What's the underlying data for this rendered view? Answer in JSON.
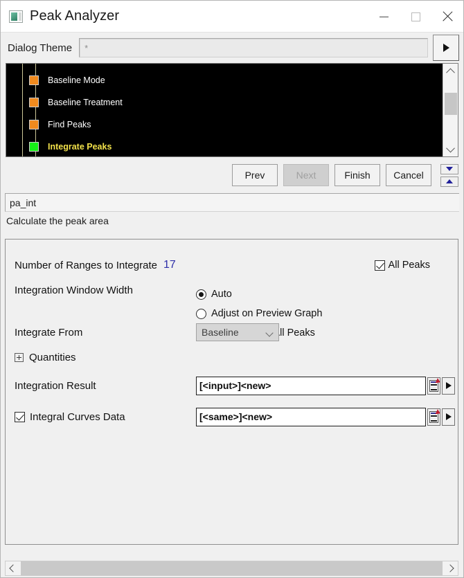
{
  "window": {
    "title": "Peak Analyzer",
    "icon": "app-window-icon",
    "minimize": "—",
    "maximize": "□",
    "close": "✕"
  },
  "theme": {
    "label": "Dialog Theme",
    "value": "*",
    "placeholder": "*",
    "arrow_button": "▶"
  },
  "tree": {
    "items": [
      {
        "label": "Baseline Mode",
        "color": "#f08a1e",
        "selected": false
      },
      {
        "label": "Baseline Treatment",
        "color": "#f08a1e",
        "selected": false
      },
      {
        "label": "Find Peaks",
        "color": "#f08a1e",
        "selected": false
      },
      {
        "label": "Integrate Peaks",
        "color": "#17f017",
        "selected": true
      }
    ],
    "scroll_up": "chevron-up",
    "scroll_down": "chevron-down"
  },
  "nav": {
    "prev": "Prev",
    "next": "Next",
    "next_disabled": true,
    "finish": "Finish",
    "cancel": "Cancel",
    "step_down": "▼",
    "step_up": "▲"
  },
  "identity": {
    "name_value": "pa_int",
    "description": "Calculate the peak area"
  },
  "form": {
    "ranges_label": "Number of Ranges to Integrate",
    "ranges_value": "17",
    "ranges_value_color": "#2d2ea8",
    "all_peaks_label": "All Peaks",
    "all_peaks_checked": true,
    "window_width_label": "Integration Window Width",
    "window_width_options": [
      {
        "label": "Auto",
        "selected": true
      },
      {
        "label": "Adjust on Preview Graph",
        "selected": false
      },
      {
        "label": "Fix Width For All Peaks",
        "selected": false
      }
    ],
    "integrate_from_label": "Integrate From",
    "integrate_from_value": "Baseline",
    "quantities_label": "Quantities",
    "integration_result_label": "Integration Result",
    "integration_result_value": "[<input>]<new>",
    "integral_curves_label": "Integral Curves Data",
    "integral_curves_checked": true,
    "integral_curves_value": "[<same>]<new>",
    "browse_icon": "worksheet-icon",
    "menu_icon": "triangle-right-icon"
  },
  "hscroll": {
    "left": "chevron-left",
    "right": "chevron-right"
  }
}
